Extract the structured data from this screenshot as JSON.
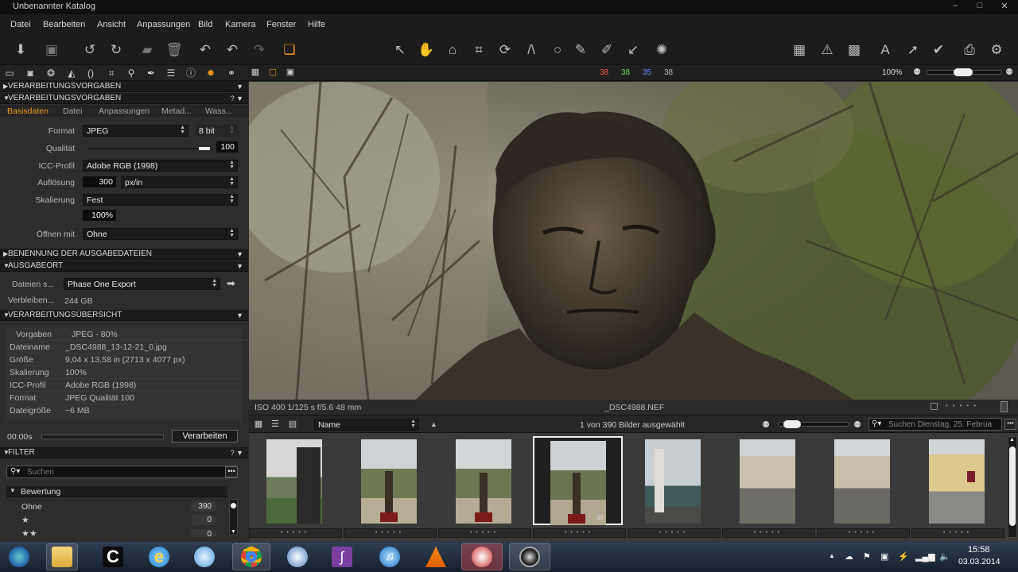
{
  "window": {
    "title": "Unbenannter Katalog",
    "minimize": "–",
    "maximize": "□",
    "close": "✕"
  },
  "menu": [
    "Datei",
    "Bearbeiten",
    "Ansicht",
    "Anpassungen",
    "Bild",
    "Kamera",
    "Fenster",
    "Hilfe"
  ],
  "viewer_bar": {
    "r": "38",
    "g": "38",
    "b": "35",
    "a": "38",
    "zoom": "100%"
  },
  "sections": {
    "proc_presets_1": "VERARBEITUNGSVORGABEN",
    "proc_presets_2": "VERARBEITUNGSVORGABEN",
    "naming": "BENENNUNG DER AUSGABEDATEIEN",
    "output_location": "AUSGABEORT",
    "summary": "VERARBEITUNGSÜBERSICHT",
    "filter": "FILTER"
  },
  "subtabs": [
    "Basisdaten",
    "Datei",
    "Anpassungen",
    "Metad...",
    "Wass..."
  ],
  "recipe": {
    "format_label": "Format",
    "format_value": "JPEG",
    "bitdepth": "8 bit",
    "quality_label": "Qualität",
    "quality_value": "100",
    "icc_label": "ICC-Profil",
    "icc_value": "Adobe RGB (1998)",
    "resolution_label": "Auflösung",
    "resolution_value": "300",
    "resolution_unit": "px/in",
    "scaling_label": "Skalierung",
    "scaling_value": "Fest",
    "scaling_percent": "100%",
    "open_with_label": "Öffnen mit",
    "open_with_value": "Ohne"
  },
  "output": {
    "files_label": "Dateien s...",
    "files_value": "Phase One Export",
    "remaining_label": "Verbleiben...",
    "remaining_value": "244 GB"
  },
  "summary_rows": [
    {
      "k": "Vorgaben",
      "v": "JPEG - 80%"
    },
    {
      "k": "Dateiname",
      "v": "_DSC4988_13-12-21_0.jpg"
    },
    {
      "k": "Größe",
      "v": "9,04  x  13,58   in  (2713  x  4077   px)"
    },
    {
      "k": "Skalierung",
      "v": "100%"
    },
    {
      "k": "ICC-Profil",
      "v": "Adobe RGB (1998)"
    },
    {
      "k": "Format",
      "v": "JPEG Qualität 100"
    },
    {
      "k": "Dateigröße",
      "v": "~6 MB"
    }
  ],
  "process": {
    "time": "00:00s",
    "button": "Verarbeiten"
  },
  "filter": {
    "search_placeholder": "Suchen",
    "rating_label": "Bewertung",
    "none_label": "Ohne",
    "none_count": "390",
    "one_star_count": "0",
    "two_star_count": "0",
    "star": "★",
    "two_star": "★★"
  },
  "infobar": {
    "exif": "ISO 400  1/125 s  f/5.6  48 mm",
    "filename": "_DSC4988.NEF"
  },
  "browser": {
    "sort_value": "Name",
    "count_text": "1 von 390 Bilder ausgewählt",
    "search_placeholder": "Suchen Dienstag, 25. Februa"
  },
  "taskbar": {
    "time": "15:58",
    "date": "03.03.2014"
  },
  "icons": {
    "toolbar": [
      "import-icon",
      "camera-icon",
      "rotate-left-icon",
      "rotate-right-icon",
      "folder-icon",
      "trash-icon",
      "undo-icon",
      "undo-icon",
      "redo-icon",
      "variants-icon",
      "select-icon",
      "hand-icon",
      "stamp-icon",
      "crop-icon",
      "rotate-icon",
      "keystone-icon",
      "circle-mask-icon",
      "brush-icon",
      "eyedropper-icon",
      "color-picker-icon",
      "spot-icon",
      "grid-icon",
      "warning-icon",
      "overlay-icon",
      "annotation-icon",
      "arrow-icon",
      "check-icon",
      "print-icon",
      "settings-icon"
    ]
  }
}
